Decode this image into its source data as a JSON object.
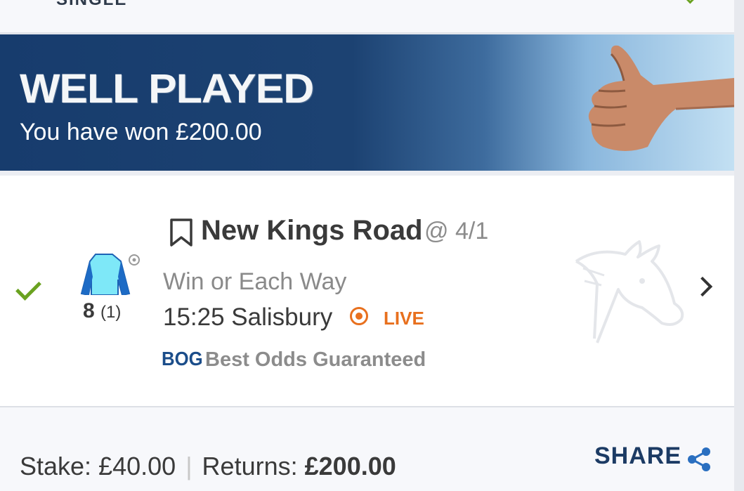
{
  "topbar": {
    "partial_text": "SINGLE"
  },
  "banner": {
    "title": "WELL PLAYED",
    "subtitle": "You have won £200.00"
  },
  "selection": {
    "runner_number": "8",
    "draw": "(1)",
    "name": "New Kings Road",
    "odds": "@ 4/1",
    "market": "Win or Each Way",
    "race_time": "15:25 Salisbury",
    "live_label": "LIVE",
    "bog_label": "BOG",
    "bog_text": "Best Odds Guaranteed"
  },
  "footer": {
    "stake_label": "Stake:",
    "stake_value": "£40.00",
    "returns_label": "Returns:",
    "returns_value": "£200.00",
    "share_label": "SHARE"
  },
  "colors": {
    "banner_dark": "#173c6d",
    "win_green": "#6aa220",
    "live_orange": "#e8701e",
    "bog_blue": "#1b4d8a"
  }
}
